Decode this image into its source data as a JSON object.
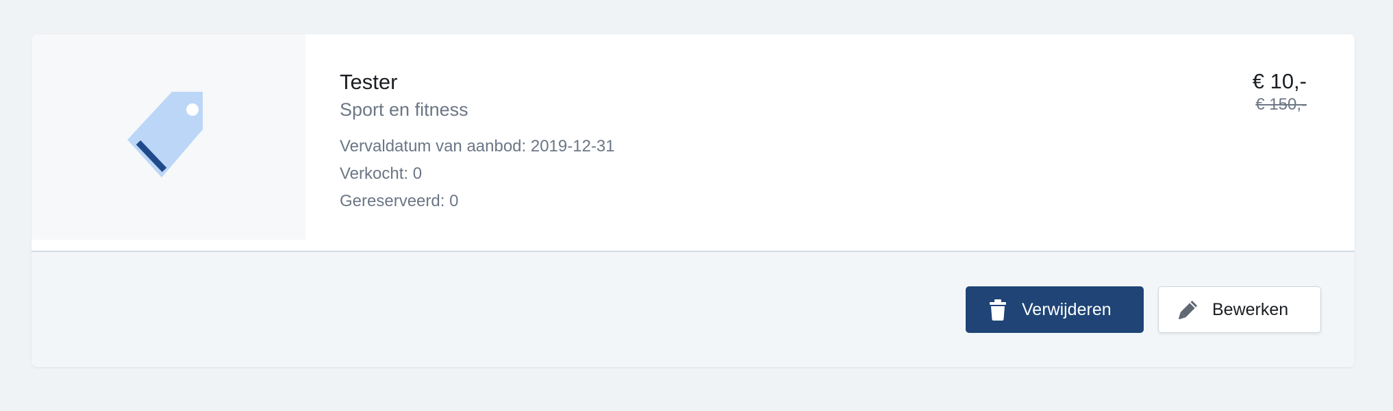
{
  "offer": {
    "title": "Tester",
    "category": "Sport en fitness",
    "expiry": "Vervaldatum van aanbod: 2019-12-31",
    "sold": "Verkocht: 0",
    "reserved": "Gereserveerd: 0",
    "thumbnail_icon": "price-tag-icon"
  },
  "price": {
    "current": "€ 10,-",
    "original": "€ 150,-"
  },
  "actions": {
    "delete_label": "Verwijderen",
    "delete_icon": "trash-icon",
    "edit_label": "Bewerken",
    "edit_icon": "pencil-icon"
  },
  "colors": {
    "primary": "#1f4475",
    "tag_light": "#bcd6f7",
    "tag_dark": "#1f4a8a",
    "muted_text": "#6b7685"
  }
}
